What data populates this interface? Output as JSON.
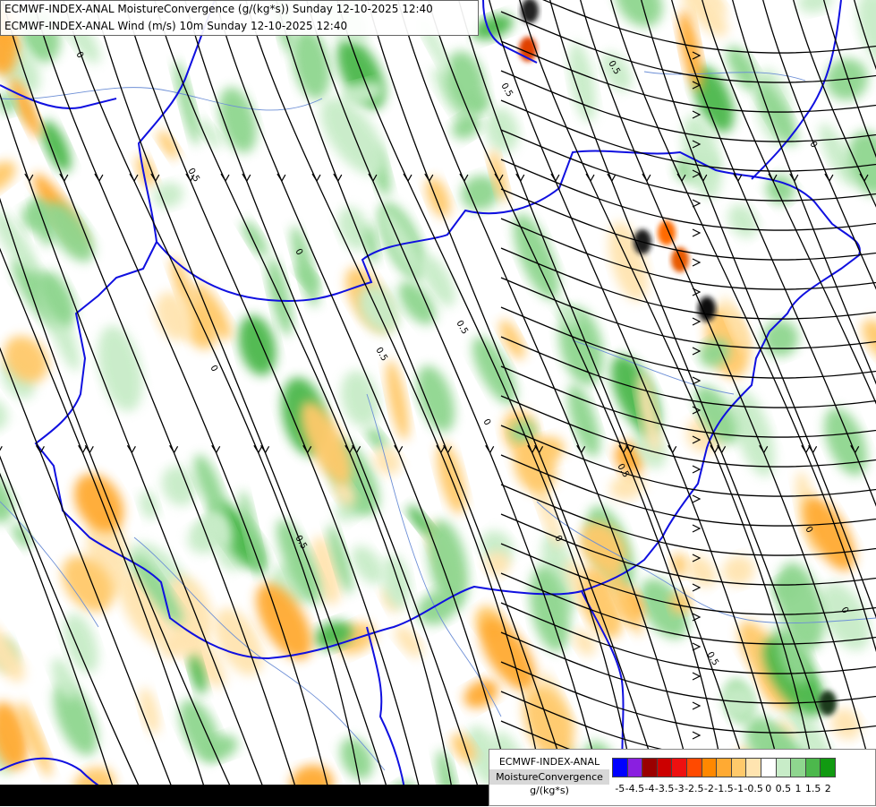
{
  "header": {
    "line1": "ECMWF-INDEX-ANAL MoistureConvergence (g/(kg*s)) Sunday 12-10-2025 12:40",
    "line2": "ECMWF-INDEX-ANAL Wind (m/s) 10m Sunday 12-10-2025 12:40"
  },
  "colors": {
    "background": "#ffffff",
    "border": "#1010e0",
    "river": "#6d8fd6",
    "streamline": "#000000",
    "contour_label": "#000000"
  },
  "map_labels": [
    "0",
    "0.5",
    "0",
    "0.5",
    "0.5",
    "0",
    "0.5",
    "0",
    "0.5",
    "0",
    "0.5",
    "0",
    "0.5",
    "0",
    "0.5",
    "0"
  ],
  "legend": {
    "model": "ECMWF-INDEX-ANAL",
    "parameter": "MoistureConvergence",
    "unit": "g/(kg*s)",
    "swatches": [
      {
        "value": -5,
        "color": "#0000ff"
      },
      {
        "value": -4.5,
        "color": "#8a1fe0"
      },
      {
        "value": -4,
        "color": "#9a0000"
      },
      {
        "value": -3.5,
        "color": "#cc0000"
      },
      {
        "value": -3,
        "color": "#ee1010"
      },
      {
        "value": -2.5,
        "color": "#ff4a00"
      },
      {
        "value": -2,
        "color": "#ff8800"
      },
      {
        "value": -1.5,
        "color": "#ffaa33"
      },
      {
        "value": -1,
        "color": "#ffc96b"
      },
      {
        "value": -0.5,
        "color": "#ffe4b0"
      },
      {
        "value": 0,
        "color": "#ffffff"
      },
      {
        "value": 0.5,
        "color": "#c8ecc8"
      },
      {
        "value": 1,
        "color": "#8fd68f"
      },
      {
        "value": 1.5,
        "color": "#4cb84c"
      },
      {
        "value": 2,
        "color": "#119a11"
      }
    ],
    "tick_labels": [
      "-5",
      "-4.5",
      "-4",
      "-3.5",
      "-3",
      "-2.5",
      "-2",
      "-1.5",
      "-1",
      "-0.5",
      "0",
      "0.5",
      "1",
      "1.5",
      "2"
    ]
  }
}
